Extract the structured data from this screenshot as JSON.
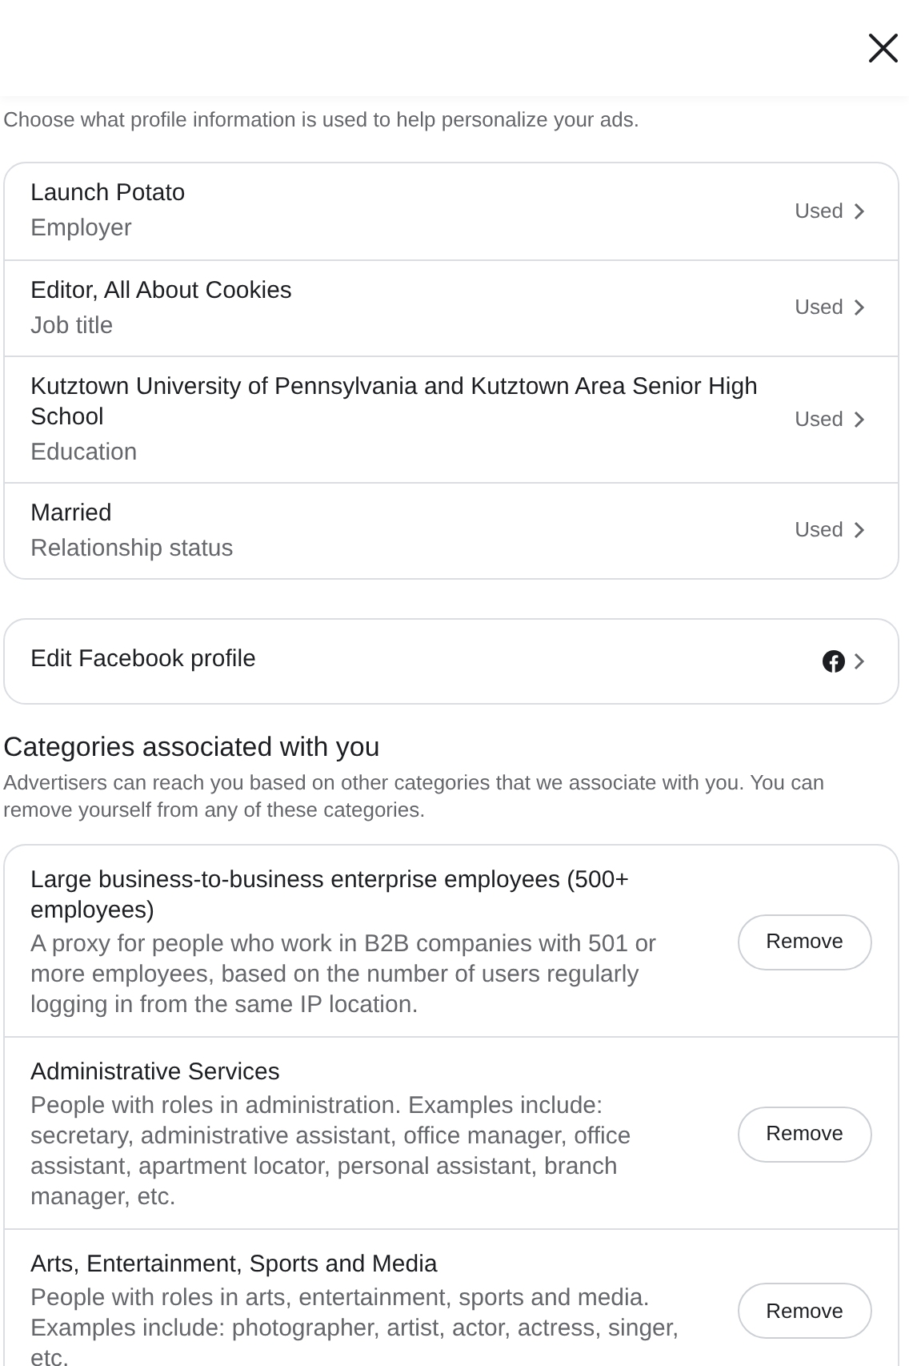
{
  "intro": "Choose what profile information is used to help personalize your ads.",
  "profile_items": [
    {
      "title": "Launch Potato",
      "subtitle": "Employer",
      "status": "Used"
    },
    {
      "title": "Editor, All About Cookies",
      "subtitle": "Job title",
      "status": "Used"
    },
    {
      "title": "Kutztown University of Pennsylvania and Kutztown Area Senior High School",
      "subtitle": "Education",
      "status": "Used"
    },
    {
      "title": "Married",
      "subtitle": "Relationship status",
      "status": "Used"
    }
  ],
  "edit_profile": {
    "label": "Edit Facebook profile"
  },
  "categories": {
    "heading": "Categories associated with you",
    "description": "Advertisers can reach you based on other categories that we associate with you. You can remove yourself from any of these categories.",
    "items": [
      {
        "title": "Large business-to-business enterprise employees (500+ employees)",
        "description": "A proxy for people who work in B2B companies with 501 or more employees, based on the number of users regularly logging in from the same IP location.",
        "action": "Remove"
      },
      {
        "title": "Administrative Services",
        "description": "People with roles in administration. Examples include: secretary, administrative assistant, office manager, office assistant, apartment locator, personal assistant, branch manager, etc.",
        "action": "Remove"
      },
      {
        "title": "Arts, Entertainment, Sports and Media",
        "description": "People with roles in arts, entertainment, sports and media. Examples include: photographer, artist, actor, actress, singer, etc.",
        "action": "Remove"
      }
    ]
  }
}
